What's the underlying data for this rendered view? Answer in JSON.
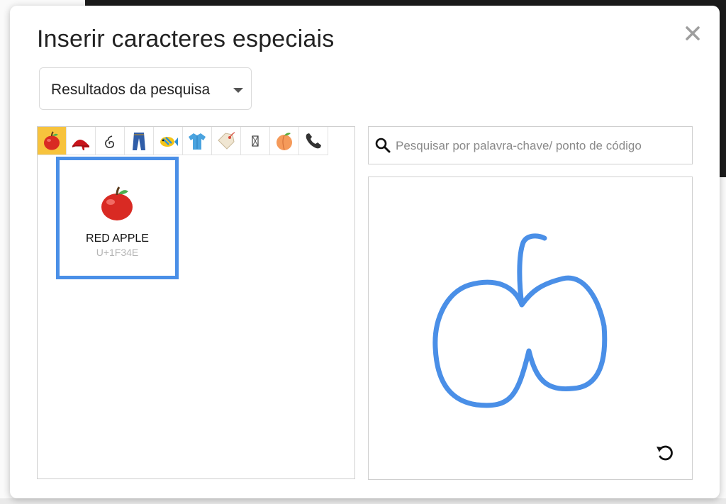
{
  "dialog": {
    "title": "Inserir caracteres especiais",
    "close_icon": "close-icon"
  },
  "dropdown": {
    "selected": "Resultados da pesquisa"
  },
  "categories": [
    {
      "icon": "red-apple-emoji",
      "active": true
    },
    {
      "icon": "high-heel-emoji"
    },
    {
      "icon": "script-glyph"
    },
    {
      "icon": "jeans-emoji"
    },
    {
      "icon": "tropical-fish-emoji"
    },
    {
      "icon": "t-shirt-emoji"
    },
    {
      "icon": "price-tag-emoji"
    },
    {
      "icon": "missing-glyph"
    },
    {
      "icon": "peach-emoji"
    },
    {
      "icon": "telephone-receiver-emoji"
    }
  ],
  "result": {
    "glyph": "🍎",
    "name": "RED APPLE",
    "code": "U+1F34E"
  },
  "search": {
    "placeholder": "Pesquisar por palavra-chave/ ponto de código",
    "value": ""
  },
  "drawing": {
    "stroke_color": "#4a8fe7",
    "reset_icon": "reset-icon"
  },
  "colors": {
    "accent": "#4a8fe7",
    "active_category": "#f7c33d"
  }
}
